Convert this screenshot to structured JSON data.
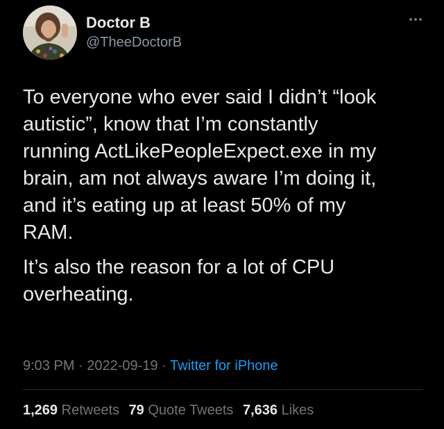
{
  "tweet": {
    "author": {
      "display_name": "Doctor B",
      "handle": "@TheeDoctorB"
    },
    "paragraphs": [
      "To everyone who ever said I didn’t “look\nautistic”, know that I’m constantly\nrunning ActLikePeopleExpect.exe in my\nbrain, am not always aware I’m doing it,\nand it’s eating up at least 50% of my\nRAM.",
      "It’s also the reason for a lot of CPU\noverheating."
    ],
    "time": "9:03 PM",
    "date": "2022-09-19",
    "separator": "·",
    "source": "Twitter for iPhone",
    "stats": {
      "retweets": {
        "count": "1,269",
        "label": "Retweets"
      },
      "quote_tweets": {
        "count": "79",
        "label": "Quote Tweets"
      },
      "likes": {
        "count": "7,636",
        "label": "Likes"
      }
    }
  },
  "colors": {
    "background": "#000000",
    "text": "#e7e9ea",
    "secondary": "#71767b",
    "link": "#1d9bf0"
  },
  "icons": {
    "more": "more-horizontal-icon"
  }
}
